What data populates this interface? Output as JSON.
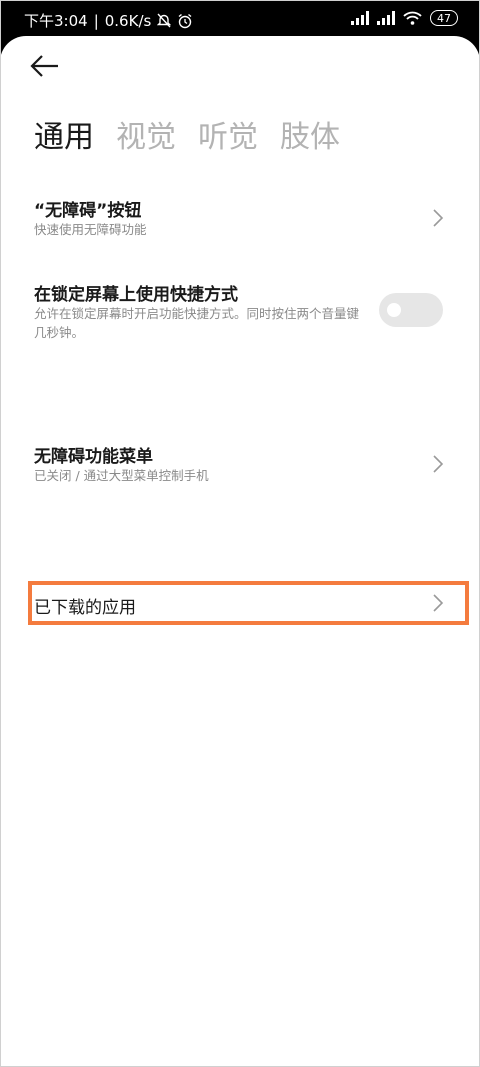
{
  "status_bar": {
    "time": "下午3:04",
    "separator": "|",
    "net_speed": "0.6K/s",
    "battery": "47",
    "icons": [
      "bell-off-icon",
      "alarm-icon",
      "signal-icon",
      "signal-icon",
      "wifi-icon",
      "battery-icon"
    ]
  },
  "tabs": [
    {
      "label": "通用",
      "active": true
    },
    {
      "label": "视觉",
      "active": false
    },
    {
      "label": "听觉",
      "active": false
    },
    {
      "label": "肢体",
      "active": false
    }
  ],
  "items": {
    "accessibility_button": {
      "title": "“无障碍”按钮",
      "subtitle": "快速使用无障碍功能"
    },
    "lock_screen_shortcut": {
      "title": "在锁定屏幕上使用快捷方式",
      "subtitle": "允许在锁定屏幕时开启功能快捷方式。同时按住两个音量键几秒钟。",
      "toggle_on": false
    },
    "accessibility_menu": {
      "title": "无障碍功能菜单",
      "subtitle": "已关闭 / 通过大型菜单控制手机"
    },
    "downloaded_apps": {
      "title": "已下载的应用"
    }
  },
  "colors": {
    "highlight": "#f47b3e",
    "tab_active": "#1a1a1a",
    "tab_inactive": "#b3b3b3",
    "subtitle": "#8a8a8a"
  }
}
